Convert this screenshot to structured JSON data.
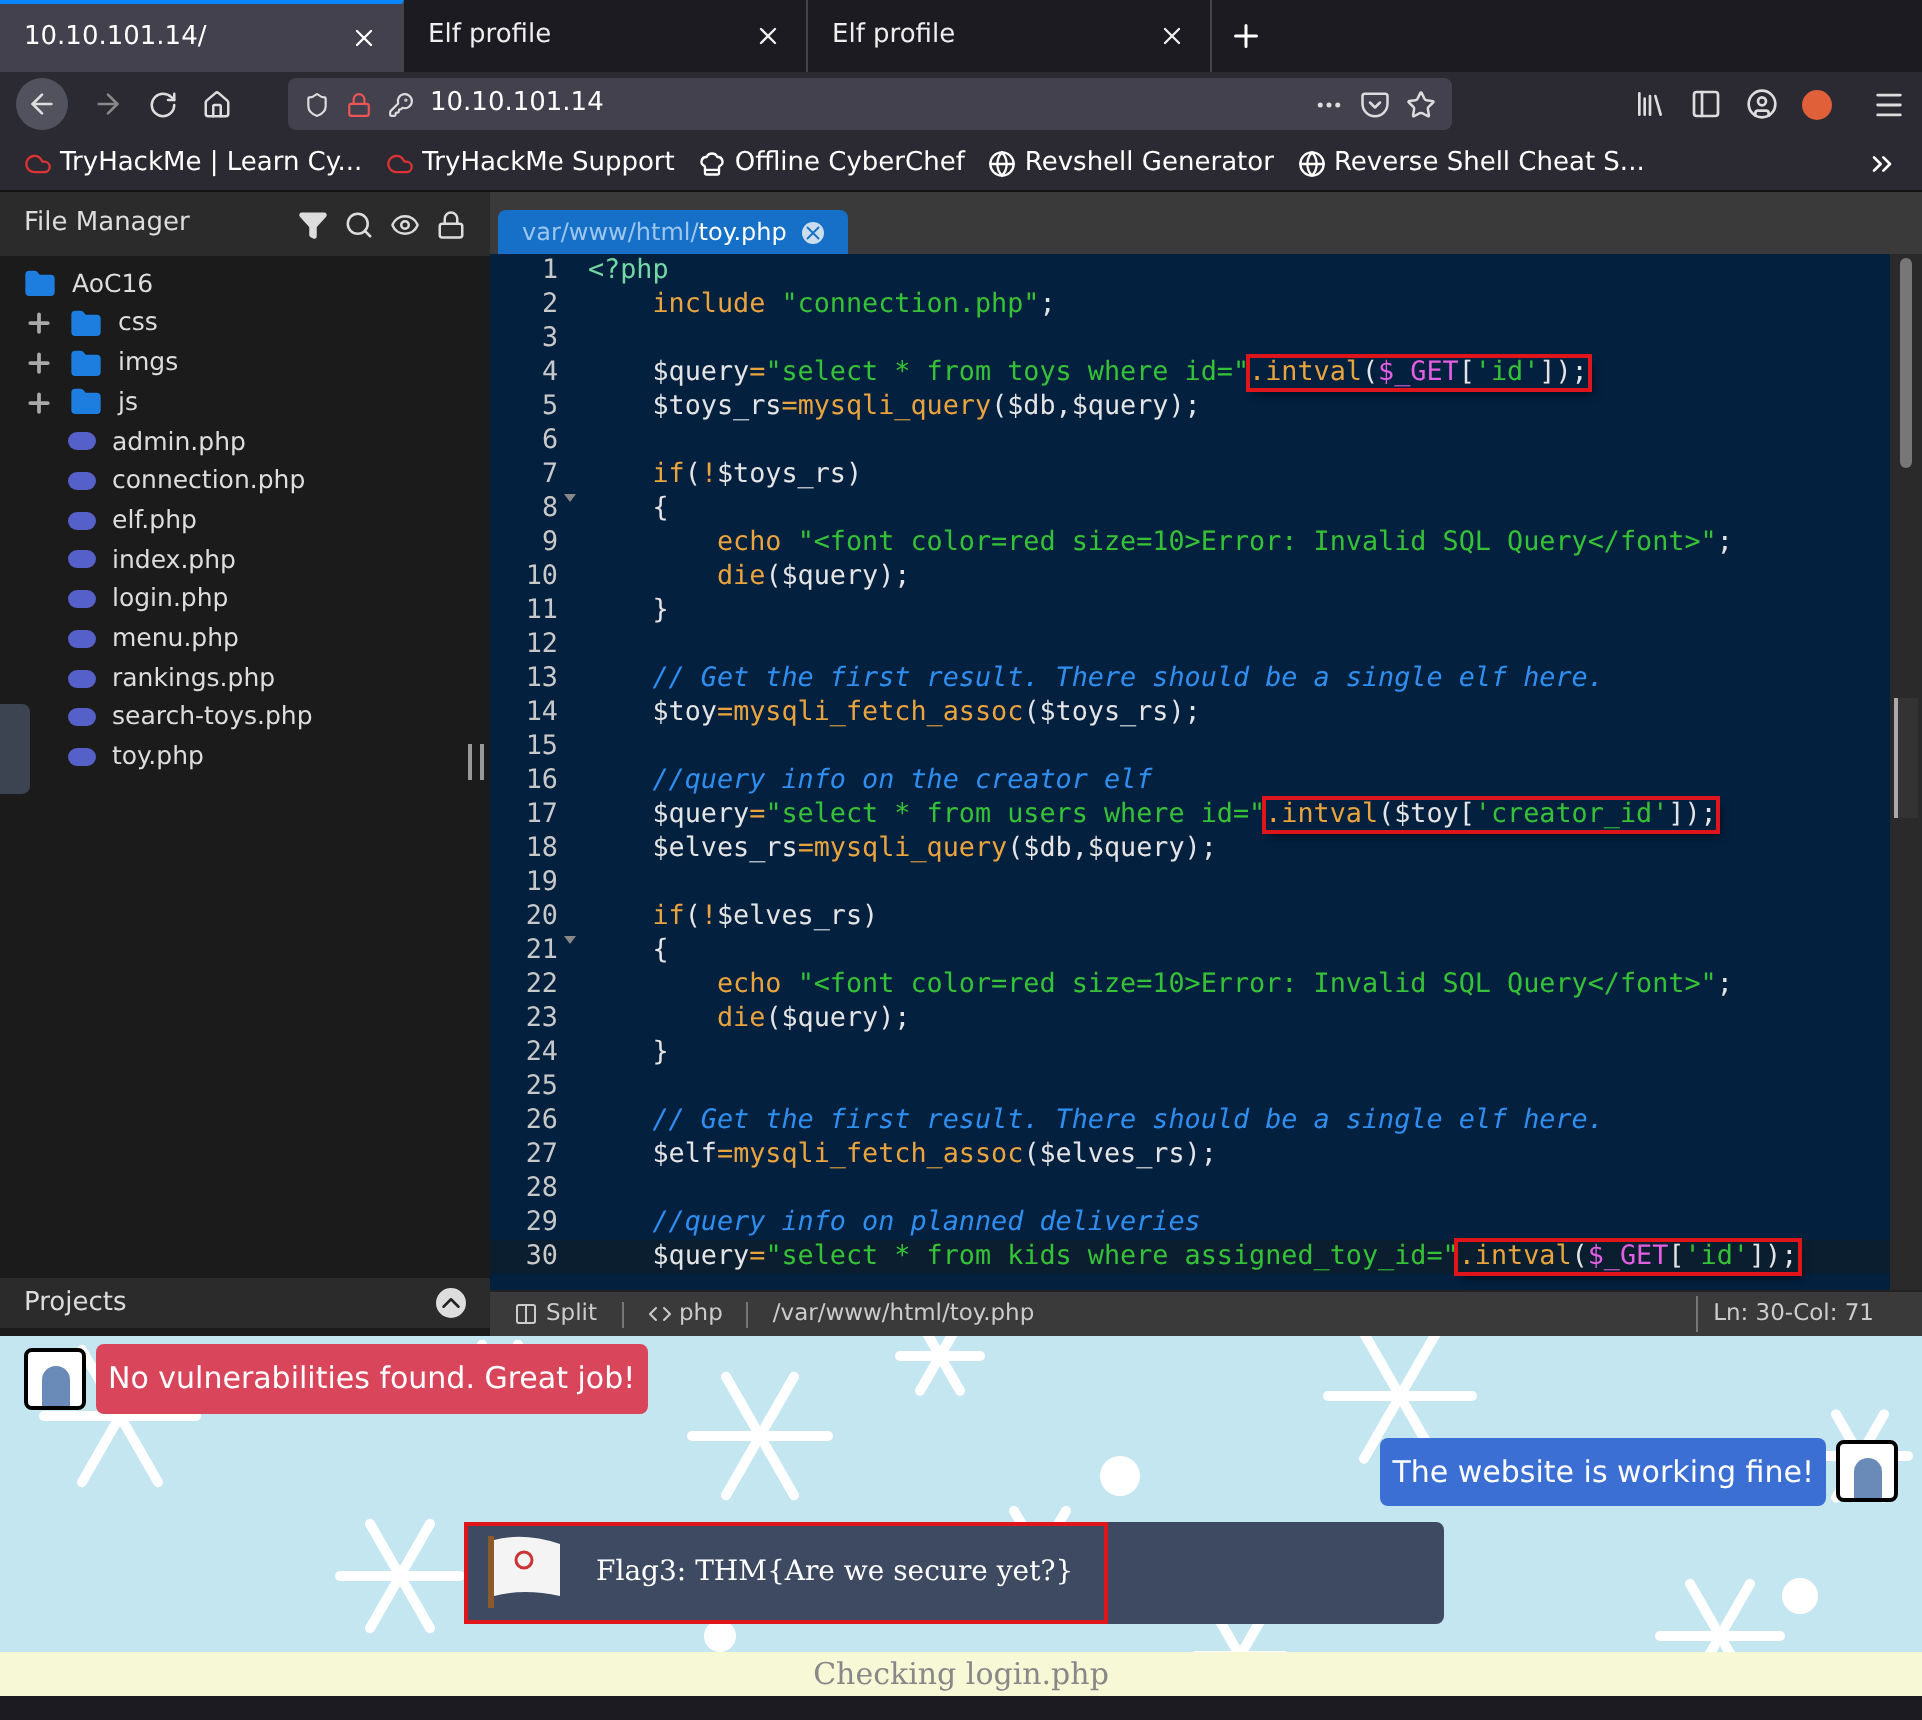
{
  "browser": {
    "tabs": [
      {
        "title": "10.10.101.14/",
        "selected": true
      },
      {
        "title": "Elf profile",
        "selected": false
      },
      {
        "title": "Elf profile",
        "selected": false
      }
    ],
    "url": "10.10.101.14",
    "bookmarks": [
      {
        "label": "TryHackMe | Learn Cy...",
        "kind": "cloud"
      },
      {
        "label": "TryHackMe Support",
        "kind": "cloud"
      },
      {
        "label": "Offline CyberChef",
        "kind": "chef"
      },
      {
        "label": "Revshell Generator",
        "kind": "globe"
      },
      {
        "label": "Reverse Shell Cheat S...",
        "kind": "globe"
      }
    ]
  },
  "file_manager": {
    "title": "File Manager",
    "tree": {
      "name": "AoC16",
      "children": [
        {
          "name": "css",
          "kind": "folder",
          "expanded": false
        },
        {
          "name": "imgs",
          "kind": "folder",
          "expanded": false
        },
        {
          "name": "js",
          "kind": "folder",
          "expanded": false
        },
        {
          "name": "admin.php",
          "kind": "php"
        },
        {
          "name": "connection.php",
          "kind": "php"
        },
        {
          "name": "elf.php",
          "kind": "php"
        },
        {
          "name": "index.php",
          "kind": "php"
        },
        {
          "name": "login.php",
          "kind": "php"
        },
        {
          "name": "menu.php",
          "kind": "php"
        },
        {
          "name": "rankings.php",
          "kind": "php"
        },
        {
          "name": "search-toys.php",
          "kind": "php"
        },
        {
          "name": "toy.php",
          "kind": "php"
        }
      ]
    },
    "projects_label": "Projects"
  },
  "editor": {
    "tab": {
      "dir": "var/www/html/",
      "file": "toy.php"
    },
    "lines": [
      {
        "number": "1",
        "fold": false,
        "current": false,
        "tokens": [
          {
            "text": "<?php",
            "kind": "tag"
          }
        ]
      },
      {
        "number": "2",
        "fold": false,
        "current": false,
        "tokens": [
          {
            "text": "    include ",
            "kind": "kw"
          },
          {
            "text": "\"connection.php\"",
            "kind": "str"
          },
          {
            "text": ";",
            "kind": "plain"
          }
        ]
      },
      {
        "number": "3",
        "fold": false,
        "current": false
      },
      {
        "number": "4",
        "fold": false,
        "current": false,
        "tokens": [
          {
            "text": "    $query",
            "kind": "plain"
          },
          {
            "text": "=",
            "kind": "kw"
          },
          {
            "text": "\"select * from toys where id=\"",
            "kind": "str"
          }
        ],
        "boxed": [
          {
            "text": ".intval",
            "kind": "kw"
          },
          {
            "text": "(",
            "kind": "plain"
          },
          {
            "text": "$_GET",
            "kind": "global"
          },
          {
            "text": "[",
            "kind": "plain"
          },
          {
            "text": "'id'",
            "kind": "str"
          },
          {
            "text": "]);",
            "kind": "plain"
          }
        ]
      },
      {
        "number": "5",
        "fold": false,
        "current": false,
        "tokens": [
          {
            "text": "    $toys_rs",
            "kind": "plain"
          },
          {
            "text": "=",
            "kind": "kw"
          },
          {
            "text": "mysqli_query",
            "kind": "kw"
          },
          {
            "text": "($db,$query);",
            "kind": "plain"
          }
        ]
      },
      {
        "number": "6",
        "fold": false,
        "current": false
      },
      {
        "number": "7",
        "fold": false,
        "current": false,
        "tokens": [
          {
            "text": "    if",
            "kind": "kw"
          },
          {
            "text": "(",
            "kind": "plain"
          },
          {
            "text": "!",
            "kind": "kw"
          },
          {
            "text": "$toys_rs)",
            "kind": "plain"
          }
        ]
      },
      {
        "number": "8",
        "fold": true,
        "current": false,
        "tokens": [
          {
            "text": "    {",
            "kind": "plain"
          }
        ]
      },
      {
        "number": "9",
        "fold": false,
        "current": false,
        "tokens": [
          {
            "text": "        echo ",
            "kind": "kw"
          },
          {
            "text": "\"<font color=red size=10>Error: Invalid SQL Query</font>\"",
            "kind": "str"
          },
          {
            "text": ";",
            "kind": "plain"
          }
        ]
      },
      {
        "number": "10",
        "fold": false,
        "current": false,
        "tokens": [
          {
            "text": "        die",
            "kind": "kw"
          },
          {
            "text": "($query);",
            "kind": "plain"
          }
        ]
      },
      {
        "number": "11",
        "fold": false,
        "current": false,
        "tokens": [
          {
            "text": "    }",
            "kind": "plain"
          }
        ]
      },
      {
        "number": "12",
        "fold": false,
        "current": false
      },
      {
        "number": "13",
        "fold": false,
        "current": false,
        "tokens": [
          {
            "text": "    // Get the first result. There should be a single elf here.",
            "kind": "comment"
          }
        ]
      },
      {
        "number": "14",
        "fold": false,
        "current": false,
        "tokens": [
          {
            "text": "    $toy",
            "kind": "plain"
          },
          {
            "text": "=",
            "kind": "kw"
          },
          {
            "text": "mysqli_fetch_assoc",
            "kind": "kw"
          },
          {
            "text": "($toys_rs);",
            "kind": "plain"
          }
        ]
      },
      {
        "number": "15",
        "fold": false,
        "current": false
      },
      {
        "number": "16",
        "fold": false,
        "current": false,
        "tokens": [
          {
            "text": "    //query info on the creator elf",
            "kind": "comment"
          }
        ]
      },
      {
        "number": "17",
        "fold": false,
        "current": false,
        "tokens": [
          {
            "text": "    $query",
            "kind": "plain"
          },
          {
            "text": "=",
            "kind": "kw"
          },
          {
            "text": "\"select * from users where id=\"",
            "kind": "str"
          }
        ],
        "boxed": [
          {
            "text": ".intval",
            "kind": "kw"
          },
          {
            "text": "($toy[",
            "kind": "plain"
          },
          {
            "text": "'creator_id'",
            "kind": "str"
          },
          {
            "text": "]);",
            "kind": "plain"
          }
        ]
      },
      {
        "number": "18",
        "fold": false,
        "current": false,
        "tokens": [
          {
            "text": "    $elves_rs",
            "kind": "plain"
          },
          {
            "text": "=",
            "kind": "kw"
          },
          {
            "text": "mysqli_query",
            "kind": "kw"
          },
          {
            "text": "($db,$query);",
            "kind": "plain"
          }
        ]
      },
      {
        "number": "19",
        "fold": false,
        "current": false
      },
      {
        "number": "20",
        "fold": false,
        "current": false,
        "tokens": [
          {
            "text": "    if",
            "kind": "kw"
          },
          {
            "text": "(",
            "kind": "plain"
          },
          {
            "text": "!",
            "kind": "kw"
          },
          {
            "text": "$elves_rs)",
            "kind": "plain"
          }
        ]
      },
      {
        "number": "21",
        "fold": true,
        "current": false,
        "tokens": [
          {
            "text": "    {",
            "kind": "plain"
          }
        ]
      },
      {
        "number": "22",
        "fold": false,
        "current": false,
        "tokens": [
          {
            "text": "        echo ",
            "kind": "kw"
          },
          {
            "text": "\"<font color=red size=10>Error: Invalid SQL Query</font>\"",
            "kind": "str"
          },
          {
            "text": ";",
            "kind": "plain"
          }
        ]
      },
      {
        "number": "23",
        "fold": false,
        "current": false,
        "tokens": [
          {
            "text": "        die",
            "kind": "kw"
          },
          {
            "text": "($query);",
            "kind": "plain"
          }
        ]
      },
      {
        "number": "24",
        "fold": false,
        "current": false,
        "tokens": [
          {
            "text": "    }",
            "kind": "plain"
          }
        ]
      },
      {
        "number": "25",
        "fold": false,
        "current": false
      },
      {
        "number": "26",
        "fold": false,
        "current": false,
        "tokens": [
          {
            "text": "    // Get the first result. There should be a single elf here.",
            "kind": "comment"
          }
        ]
      },
      {
        "number": "27",
        "fold": false,
        "current": false,
        "tokens": [
          {
            "text": "    $elf",
            "kind": "plain"
          },
          {
            "text": "=",
            "kind": "kw"
          },
          {
            "text": "mysqli_fetch_assoc",
            "kind": "kw"
          },
          {
            "text": "($elves_rs);",
            "kind": "plain"
          }
        ]
      },
      {
        "number": "28",
        "fold": false,
        "current": false
      },
      {
        "number": "29",
        "fold": false,
        "current": false,
        "tokens": [
          {
            "text": "    //query info on planned deliveries",
            "kind": "comment"
          }
        ]
      },
      {
        "number": "30",
        "fold": false,
        "current": true,
        "tokens": [
          {
            "text": "    $query",
            "kind": "plain"
          },
          {
            "text": "=",
            "kind": "kw"
          },
          {
            "text": "\"select * from kids where assigned_toy_id=\"",
            "kind": "str"
          }
        ],
        "boxed": [
          {
            "text": ".intval",
            "kind": "kw"
          },
          {
            "text": "(",
            "kind": "plain"
          },
          {
            "text": "$_GET",
            "kind": "global"
          },
          {
            "text": "[",
            "kind": "plain"
          },
          {
            "text": "'id'",
            "kind": "str"
          },
          {
            "text": "]);",
            "kind": "plain"
          }
        ]
      }
    ],
    "status": {
      "mode": "Split",
      "language": "php",
      "path": "/var/www/html/toy.php",
      "position": "Ln: 30-Col: 71"
    }
  },
  "page": {
    "messages": [
      {
        "text": "No vulnerabilities found. Great job!",
        "kind": "left",
        "color": "#d9455a"
      },
      {
        "text": "The website is working fine!",
        "kind": "right",
        "color": "#3b6fd4"
      }
    ],
    "flag": "Flag3: THM{Are we secure yet?}",
    "checking": "Checking login.php"
  }
}
